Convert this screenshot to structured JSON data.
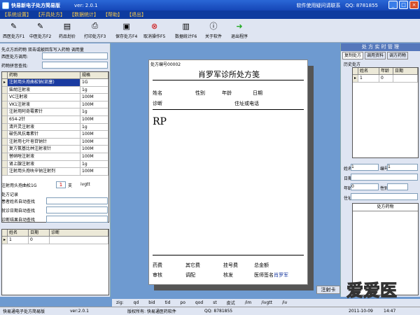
{
  "window": {
    "title": "快易新电子处方简易版",
    "version": "ver: 2.0.1",
    "contact": "软件使用疑问请联系",
    "qq": "QQ: 8781855"
  },
  "menu": [
    "【系统设置】",
    "【开具处方】",
    "【数据统计】",
    "【帮助】",
    "【退出】"
  ],
  "toolbar": [
    {
      "label": "西医处方F1",
      "icon": "pencil-icon"
    },
    {
      "label": "中医处方F2",
      "icon": "pencil-icon"
    },
    {
      "label": "药品划价",
      "icon": "book-icon"
    },
    {
      "label": "打印处方F3",
      "icon": "printer-icon"
    },
    {
      "label": "保存处方F4",
      "icon": "save-icon"
    },
    {
      "label": "取消操作F5",
      "icon": "cancel-icon"
    },
    {
      "label": "数据统计F6",
      "icon": "chart-icon"
    },
    {
      "label": "关于软件",
      "icon": "info-icon"
    },
    {
      "label": "退出程序",
      "icon": "exit-icon"
    }
  ],
  "left": {
    "hint": "先点方后药物 双击或敲回车写入药物 调用量",
    "western_call": "西医处方调用:",
    "pinyin_search": "药物拼音查找:",
    "grid_headers": [
      "药物",
      "规格"
    ],
    "drugs": [
      {
        "name": "注射用头孢曲松钠(凯塞)",
        "spec": "1G"
      },
      {
        "name": "柴胡注射液",
        "spec": "1g"
      },
      {
        "name": "VC注射液",
        "spec": "100M"
      },
      {
        "name": "VK1注射液",
        "spec": "100M"
      },
      {
        "name": "注射用阿奇霉素针",
        "spec": "1g"
      },
      {
        "name": "654-2针",
        "spec": "100M"
      },
      {
        "name": "清开灵注射液",
        "spec": "1g"
      },
      {
        "name": "破伤风抗毒素针",
        "spec": "100M"
      },
      {
        "name": "注射用七叶皂苷钠针",
        "spec": "100M"
      },
      {
        "name": "复方氨基比林注射液针",
        "spec": "100M"
      },
      {
        "name": "替硝唑注射液",
        "spec": "100M"
      },
      {
        "name": "肾上腺注射液",
        "spec": "1g"
      },
      {
        "name": "注射用头孢呋辛钠注射剂",
        "spec": "100M"
      }
    ],
    "selected_drug": "注射用头孢曲松1G",
    "qty": "1",
    "unit": "支",
    "usage": "ivgtt",
    "records_title": "处方记录",
    "search_name": "患者姓名自动查找",
    "search_date": "就诊日期自动查找",
    "search_diag": "诊断结果自动查找",
    "rec_headers": [
      "姓名",
      "日期",
      "诊断"
    ],
    "rec_row": [
      "1",
      "0",
      ""
    ]
  },
  "paper": {
    "no_label": "处方编号00002",
    "title": "肖罗军诊所处方笺",
    "name": "姓名",
    "gender": "性别",
    "age": "年龄",
    "date": "日期",
    "diag": "诊断",
    "addr": "住址或电话",
    "rp": "RP",
    "fee_drug": "药费",
    "fee_other": "其它费",
    "fee_reg": "挂号费",
    "fee_total": "总金额",
    "review": "审核",
    "dispense": "调配",
    "check": "核发",
    "doctor_label": "医师签名",
    "doctor": "肖罗军"
  },
  "right": {
    "title": "处 方 实 时 管 理",
    "tabs": [
      "复制处方",
      "调用资料",
      "调方药物"
    ],
    "history": "历史处方",
    "hist_headers": [
      "姓名",
      "年龄",
      "日期"
    ],
    "hist_row": [
      "1",
      "0",
      ""
    ],
    "name": "姓名",
    "num": "编号",
    "date": "日期",
    "age": "年龄",
    "gender": "性别",
    "addr": "住址",
    "name_val": "1",
    "num_val": "1",
    "age_val": "0",
    "drugs_title": "处方药物"
  },
  "inject_card": "注射卡",
  "shortcuts": [
    "zig:",
    "qd",
    "bid",
    "tid",
    "po",
    "qod",
    "st",
    "皮试",
    "/im",
    "/ivgtt",
    "/iv"
  ],
  "status": {
    "app": "快易通电子处方简易版",
    "ver": "ver:2.0.1",
    "copyright": "版权所有: 快易通医药软件",
    "qq": "QQ: 8781855",
    "date": "2011-10-09",
    "time": "14:47"
  },
  "watermark": "爱爱医"
}
